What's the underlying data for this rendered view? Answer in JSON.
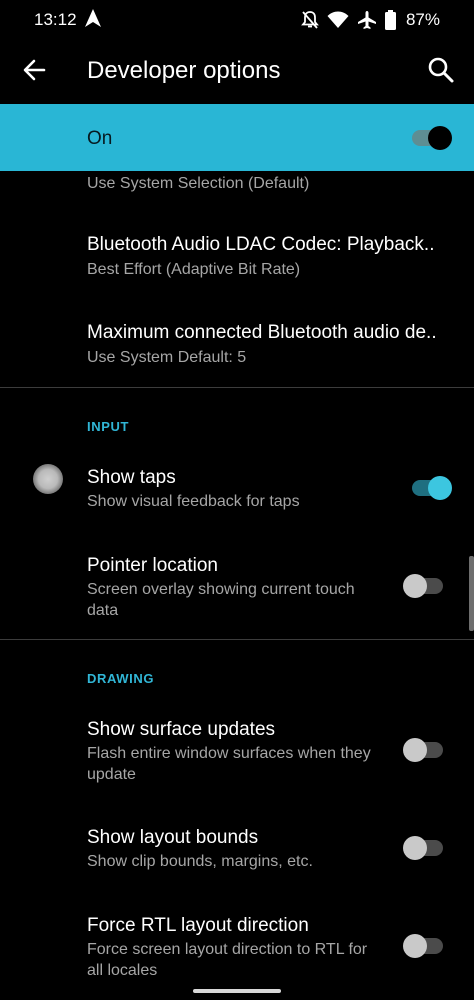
{
  "status": {
    "time": "13:12",
    "battery": "87%"
  },
  "appbar": {
    "title": "Developer options"
  },
  "master": {
    "label": "On",
    "enabled": true
  },
  "items": [
    {
      "subtitle": "Use System Selection (Default)"
    },
    {
      "title": "Bluetooth Audio LDAC Codec: Playback..",
      "subtitle": "Best Effort (Adaptive Bit Rate)"
    },
    {
      "title": "Maximum connected Bluetooth audio de..",
      "subtitle": "Use System Default: 5"
    }
  ],
  "sections": {
    "input": "INPUT",
    "drawing": "DRAWING"
  },
  "input_items": [
    {
      "title": "Show taps",
      "subtitle": "Show visual feedback for taps",
      "enabled": true
    },
    {
      "title": "Pointer location",
      "subtitle": "Screen overlay showing current touch data",
      "enabled": false
    }
  ],
  "drawing_items": [
    {
      "title": "Show surface updates",
      "subtitle": "Flash entire window surfaces when they update",
      "enabled": false
    },
    {
      "title": "Show layout bounds",
      "subtitle": "Show clip bounds, margins, etc.",
      "enabled": false
    },
    {
      "title": "Force RTL layout direction",
      "subtitle": "Force screen layout direction to RTL for all locales",
      "enabled": false
    }
  ],
  "colors": {
    "accent": "#29b6d5",
    "background": "#000000"
  }
}
